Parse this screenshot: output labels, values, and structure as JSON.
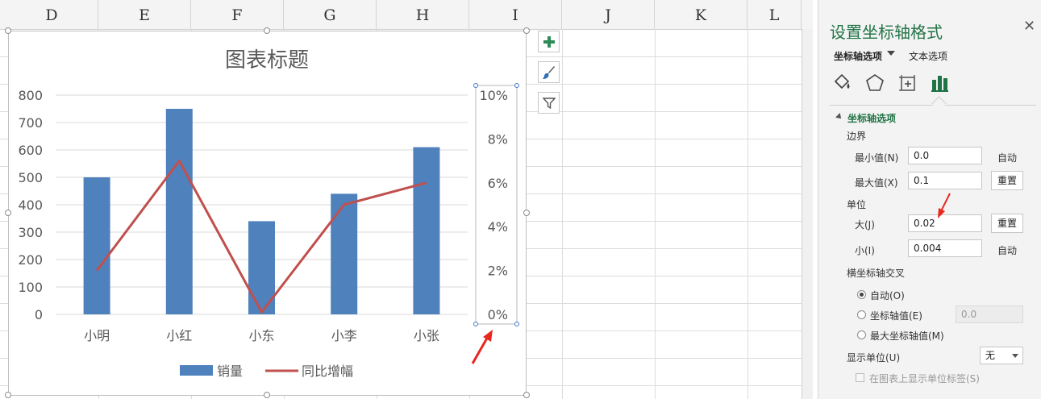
{
  "sheet": {
    "columns": [
      "D",
      "E",
      "F",
      "G",
      "H",
      "I",
      "J",
      "K",
      "L"
    ]
  },
  "chart_data": {
    "type": "bar",
    "title": "图表标题",
    "categories": [
      "小明",
      "小红",
      "小东",
      "小李",
      "小张"
    ],
    "series": [
      {
        "name": "销量",
        "type": "bar",
        "axis": "left",
        "color": "#4f81bd",
        "values": [
          500,
          750,
          340,
          440,
          610
        ]
      },
      {
        "name": "同比增幅",
        "type": "line",
        "axis": "right",
        "color": "#c0504d",
        "values": [
          0.02,
          0.07,
          0.001,
          0.05,
          0.06
        ]
      }
    ],
    "y_left": {
      "min": 0,
      "max": 800,
      "step": 100,
      "ticks": [
        "0",
        "100",
        "200",
        "300",
        "400",
        "500",
        "600",
        "700",
        "800"
      ]
    },
    "y_right": {
      "min": 0,
      "max": 0.1,
      "step": 0.02,
      "ticks": [
        "0%",
        "2%",
        "4%",
        "6%",
        "8%",
        "10%"
      ]
    },
    "grid": true,
    "legend_position": "bottom"
  },
  "pane": {
    "title": "设置坐标轴格式",
    "close": "✕",
    "tabs": {
      "axis_options": "坐标轴选项",
      "text_options": "文本选项"
    },
    "icons": [
      "fill-line-icon",
      "effects-pentagon-icon",
      "size-properties-icon",
      "axis-options-bar-icon"
    ],
    "section": "坐标轴选项",
    "bounds_label": "边界",
    "min_label": "最小值(N)",
    "min_value": "0.0",
    "min_auto": "自动",
    "max_label": "最大值(X)",
    "max_value": "0.1",
    "max_reset": "重置",
    "units_label": "单位",
    "major_label": "大(J)",
    "major_value": "0.02",
    "major_reset": "重置",
    "minor_label": "小(I)",
    "minor_value": "0.004",
    "minor_auto": "自动",
    "cross_label": "横坐标轴交叉",
    "radio_auto": "自动(O)",
    "radio_axis_value": "坐标轴值(E)",
    "axis_value": "0.0",
    "radio_max": "最大坐标轴值(M)",
    "display_units_label": "显示单位(U)",
    "display_units_value": "无",
    "show_units_label": "在图表上显示单位标签(S)"
  }
}
